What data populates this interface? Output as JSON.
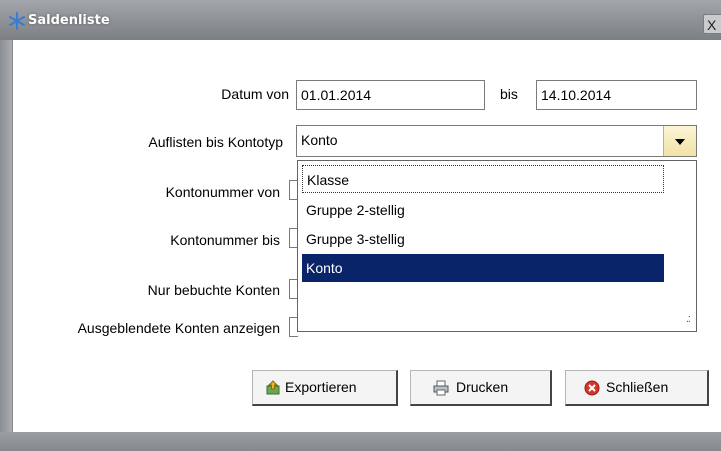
{
  "window": {
    "title": "Saldenliste",
    "close_label": "X"
  },
  "form": {
    "datum_von_label": "Datum von",
    "datum_von_value": "01.01.2014",
    "bis_label": "bis",
    "bis_value": "14.10.2014",
    "kontotyp_label": "Auflisten bis Kontotyp",
    "kontotyp_value": "Konto",
    "kontonummer_von_label": "Kontonummer von",
    "kontonummer_bis_label": "Kontonummer bis",
    "nur_bebuchte_label": "Nur bebuchte Konten",
    "ausgeblendete_label": "Ausgeblendete Konten anzeigen"
  },
  "dropdown": {
    "options": [
      "Klasse",
      "Gruppe 2-stellig",
      "Gruppe 3-stellig",
      "Konto"
    ],
    "selected": "Konto",
    "focused": "Klasse"
  },
  "buttons": {
    "export_label": "Exportieren",
    "print_label": "Drucken",
    "close_label": "Schließen"
  },
  "icons": {
    "title": "snowflake-icon",
    "export": "export-icon",
    "print": "printer-icon",
    "close": "close-circle-icon"
  },
  "colors": {
    "selection": "#0a246a",
    "combo_button": "#f2e2a6",
    "close_red": "#d8352a"
  }
}
